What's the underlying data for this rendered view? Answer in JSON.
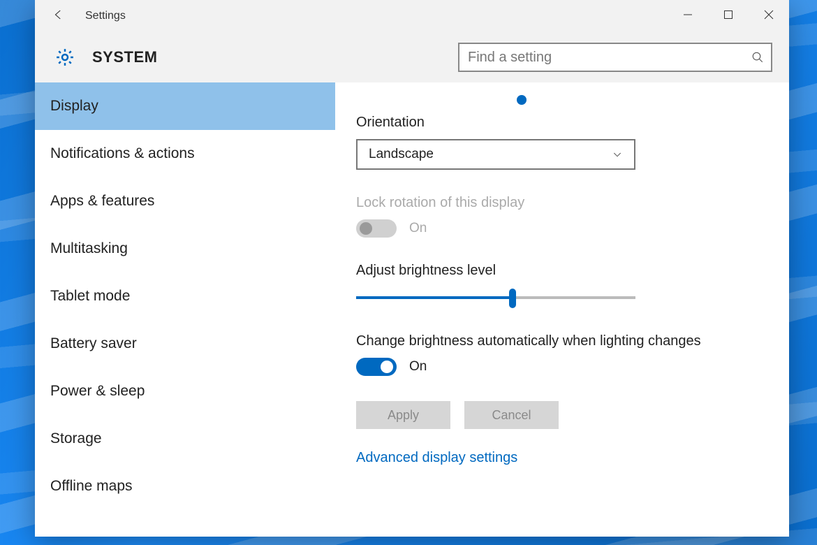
{
  "titlebar": {
    "title": "Settings"
  },
  "header": {
    "system_label": "SYSTEM",
    "search_placeholder": "Find a setting"
  },
  "sidebar": {
    "items": [
      {
        "label": "Display",
        "active": true
      },
      {
        "label": "Notifications & actions",
        "active": false
      },
      {
        "label": "Apps & features",
        "active": false
      },
      {
        "label": "Multitasking",
        "active": false
      },
      {
        "label": "Tablet mode",
        "active": false
      },
      {
        "label": "Battery saver",
        "active": false
      },
      {
        "label": "Power & sleep",
        "active": false
      },
      {
        "label": "Storage",
        "active": false
      },
      {
        "label": "Offline maps",
        "active": false
      }
    ]
  },
  "content": {
    "orientation": {
      "label": "Orientation",
      "value": "Landscape"
    },
    "lock_rotation": {
      "label": "Lock rotation of this display",
      "state_label": "On",
      "enabled": false
    },
    "brightness": {
      "label": "Adjust brightness level",
      "percent": 56
    },
    "auto_brightness": {
      "label": "Change brightness automatically when lighting changes",
      "state_label": "On",
      "on": true
    },
    "buttons": {
      "apply": "Apply",
      "cancel": "Cancel"
    },
    "advanced_link": "Advanced display settings"
  }
}
